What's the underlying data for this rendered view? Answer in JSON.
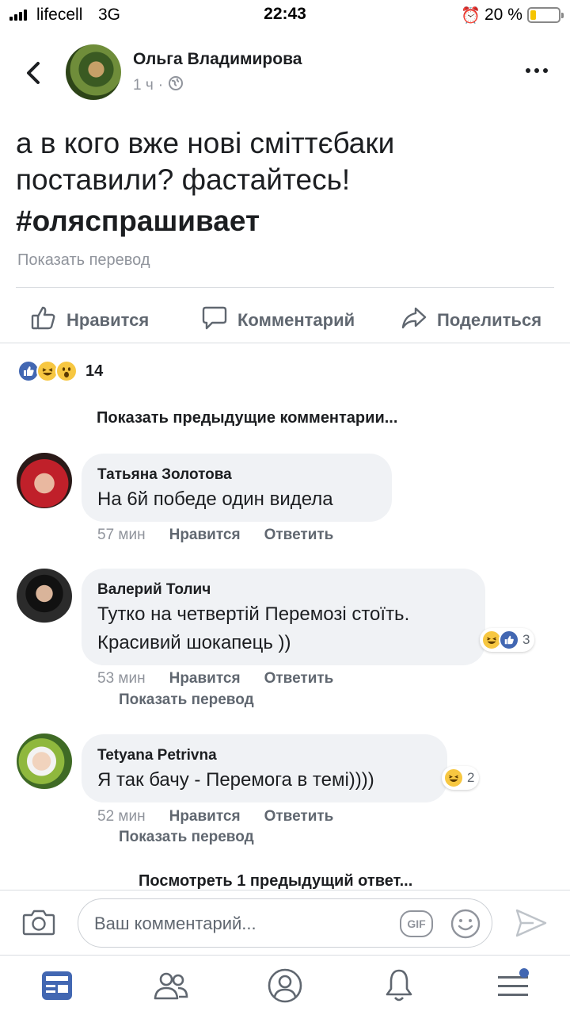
{
  "status_bar": {
    "carrier": "lifecell",
    "network": "3G",
    "time": "22:43",
    "battery_percent": "20 %",
    "battery_level": 0.2
  },
  "post": {
    "author": "Ольга Владимирова",
    "time": "1 ч",
    "text": "а в кого вже нові сміттєбаки поставили? фастайтесь!",
    "hashtag": "#оляспрашивает",
    "show_translation": "Показать перевод"
  },
  "actions": {
    "like": "Нравится",
    "comment": "Комментарий",
    "share": "Поделиться"
  },
  "reactions": {
    "types": [
      "like-icon",
      "haha-icon",
      "wow-icon"
    ],
    "count": "14"
  },
  "comments_section": {
    "show_previous": "Показать предыдущие комментарии...",
    "view_previous_reply": "Посмотреть 1 предыдущий ответ...",
    "like_label": "Нравится",
    "reply_label": "Ответить",
    "translate_label": "Показать перевод",
    "items": [
      {
        "name": "Татьяна Золотова",
        "text": "На 6й победе один видела",
        "time": "57 мин"
      },
      {
        "name": "Валерий Толич",
        "text_line1": "Тутко на четвертій Перемозі стоїть.",
        "text_line2": "Красивий шокапець ))",
        "time": "53 мин",
        "reaction_count": "3"
      },
      {
        "name": "Tetyana Petrivna",
        "text": "Я так бачу - Перемога в темі))))",
        "time": "52 мин",
        "reaction_count": "2"
      }
    ]
  },
  "composer": {
    "placeholder": "Ваш комментарий...",
    "gif_label": "GIF"
  },
  "colors": {
    "accent": "#4267b2",
    "secondary_text": "#90949c",
    "bubble": "#f0f2f5"
  }
}
